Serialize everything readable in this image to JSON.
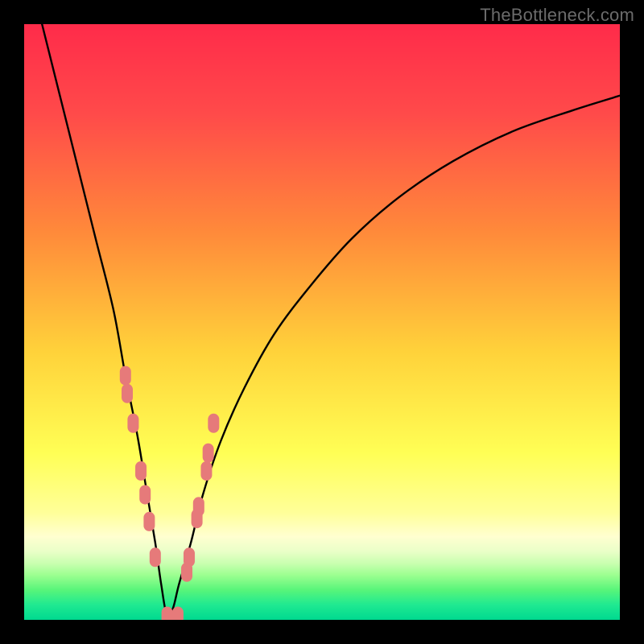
{
  "watermark": {
    "text": "TheBottleneck.com"
  },
  "colors": {
    "frame": "#000000",
    "curve": "#000000",
    "marker_fill": "#e67a7a",
    "marker_stroke": "#cf5b5b",
    "gradient_stops": [
      {
        "offset": 0.0,
        "color": "#ff2b4a"
      },
      {
        "offset": 0.15,
        "color": "#ff4a4a"
      },
      {
        "offset": 0.35,
        "color": "#ff8a3a"
      },
      {
        "offset": 0.55,
        "color": "#ffd23a"
      },
      {
        "offset": 0.72,
        "color": "#ffff55"
      },
      {
        "offset": 0.82,
        "color": "#ffff99"
      },
      {
        "offset": 0.86,
        "color": "#ffffd0"
      },
      {
        "offset": 0.885,
        "color": "#eaffc8"
      },
      {
        "offset": 0.905,
        "color": "#c9ffb0"
      },
      {
        "offset": 0.925,
        "color": "#9cff90"
      },
      {
        "offset": 0.95,
        "color": "#57f57a"
      },
      {
        "offset": 0.975,
        "color": "#1fe991"
      },
      {
        "offset": 1.0,
        "color": "#00d98f"
      }
    ]
  },
  "chart_data": {
    "type": "line",
    "title": "",
    "xlabel": "",
    "ylabel": "",
    "xlim": [
      0,
      100
    ],
    "ylim": [
      0,
      100
    ],
    "note": "V-shaped bottleneck curve. X is relative component balance (arbitrary 0–100). Y is bottleneck percentage (0 = perfect at bottom, 100 = severe at top). Minimum around x≈24. Values estimated from pixel positions; chart has no axis ticks.",
    "series": [
      {
        "name": "bottleneck-curve",
        "x": [
          3,
          6,
          9,
          12,
          15,
          17,
          19,
          20.5,
          22,
          23,
          24,
          25,
          26,
          28,
          30,
          33,
          37,
          42,
          48,
          55,
          63,
          72,
          82,
          92,
          100
        ],
        "y": [
          100,
          88,
          76,
          64,
          52,
          41,
          31,
          22,
          13,
          6,
          0.5,
          2,
          6,
          13,
          21,
          30,
          39,
          48,
          56,
          64,
          71,
          77,
          82,
          85.5,
          88
        ]
      }
    ],
    "markers": {
      "name": "highlighted-points",
      "shape": "rounded-capsule",
      "x": [
        17.0,
        17.3,
        18.3,
        19.6,
        20.3,
        21.0,
        22.0,
        24.0,
        25.8,
        27.3,
        27.7,
        29.0,
        29.3,
        30.6,
        30.9,
        31.8
      ],
      "y": [
        41,
        38,
        33,
        25,
        21,
        16.5,
        10.5,
        0.6,
        0.6,
        8,
        10.5,
        17,
        19,
        25,
        28,
        33
      ]
    }
  }
}
